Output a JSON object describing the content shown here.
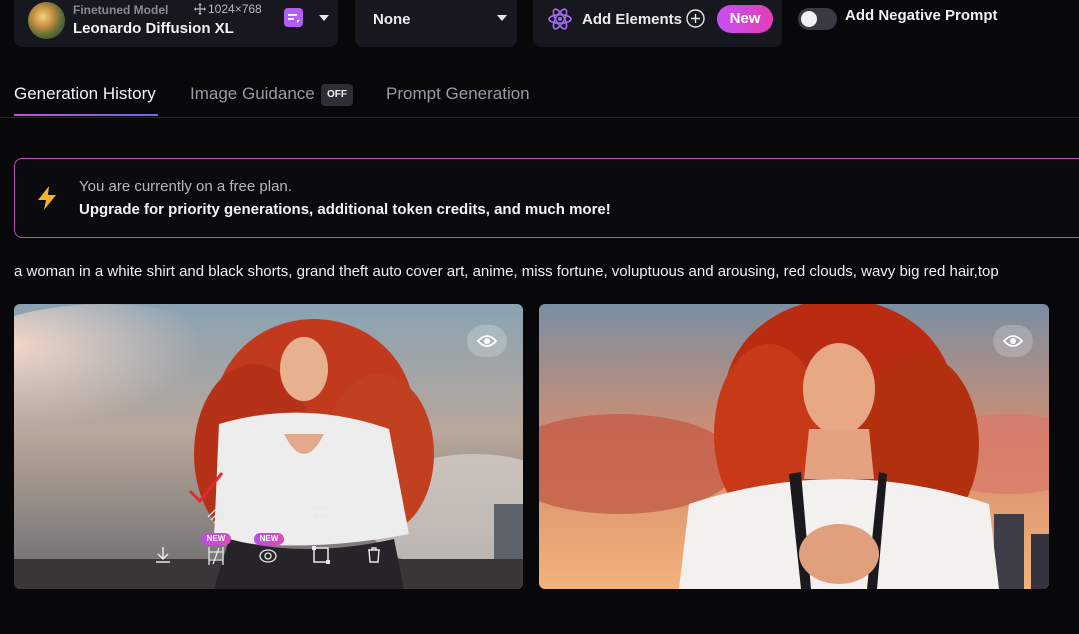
{
  "toolbar": {
    "model": {
      "caption": "Finetuned Model",
      "name": "Leonardo Diffusion XL",
      "dimensions": "1024×768",
      "thumbnail_icon": "model-thumbnail"
    },
    "style": {
      "value": "None"
    },
    "elements": {
      "label": "Add Elements",
      "badge": "New",
      "icon": "atom-icon"
    },
    "negative_prompt": {
      "label": "Add Negative Prompt",
      "enabled": false
    }
  },
  "tabs": {
    "items": [
      {
        "label": "Generation History",
        "active": true
      },
      {
        "label": "Image Guidance",
        "badge": "OFF",
        "active": false
      },
      {
        "label": "Prompt Generation",
        "active": false
      }
    ]
  },
  "banner": {
    "line1": "You are currently on a free plan.",
    "line2": "Upgrade for priority generations, additional token credits, and much more!",
    "icon": "lightning-icon"
  },
  "prompt": {
    "text": "a woman in a white shirt and black shorts, grand theft auto cover art, anime, miss fortune, voluptuous and arousing, red clouds, wavy big red hair,top"
  },
  "images": {
    "actions": [
      {
        "icon": "download-icon"
      },
      {
        "icon": "unzoom-icon",
        "badge": "NEW"
      },
      {
        "icon": "remove-background-icon",
        "badge": "NEW"
      },
      {
        "icon": "crop-icon"
      },
      {
        "icon": "delete-icon"
      }
    ],
    "mini_new_1": "NEW",
    "mini_new_2": "NEW"
  },
  "colors": {
    "accent_pink": "#e23fb7",
    "accent_purple": "#b25ef0",
    "banner_border": "#c24bb8",
    "background": "#08080b"
  }
}
